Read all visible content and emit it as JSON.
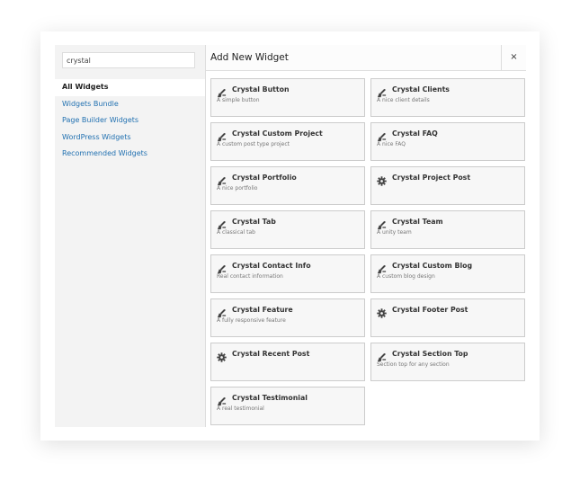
{
  "search": {
    "value": "crystal"
  },
  "sidebar": {
    "items": [
      {
        "label": "All Widgets",
        "active": true
      },
      {
        "label": "Widgets Bundle"
      },
      {
        "label": "Page Builder Widgets"
      },
      {
        "label": "WordPress Widgets"
      },
      {
        "label": "Recommended Widgets"
      }
    ]
  },
  "header": {
    "title": "Add New Widget",
    "close": "×"
  },
  "widgets": [
    {
      "name": "Crystal Button",
      "desc": "A simple button",
      "icon": "brush"
    },
    {
      "name": "Crystal Clients",
      "desc": "A nice client details",
      "icon": "brush"
    },
    {
      "name": "Crystal Custom Project",
      "desc": "A custom post type project",
      "icon": "brush"
    },
    {
      "name": "Crystal FAQ",
      "desc": "A nice FAQ",
      "icon": "brush"
    },
    {
      "name": "Crystal Portfolio",
      "desc": "A nice portfolio",
      "icon": "brush"
    },
    {
      "name": "Crystal Project Post",
      "desc": "",
      "icon": "gear"
    },
    {
      "name": "Crystal Tab",
      "desc": "A classical tab",
      "icon": "brush"
    },
    {
      "name": "Crystal Team",
      "desc": "A unity team",
      "icon": "brush"
    },
    {
      "name": "Crystal Contact Info",
      "desc": "Real contact information",
      "icon": "brush"
    },
    {
      "name": "Crystal Custom Blog",
      "desc": "A custom blog design",
      "icon": "brush"
    },
    {
      "name": "Crystal Feature",
      "desc": "A fully responsive feature",
      "icon": "brush"
    },
    {
      "name": "Crystal Footer Post",
      "desc": "",
      "icon": "gear"
    },
    {
      "name": "Crystal Recent Post",
      "desc": "",
      "icon": "gear"
    },
    {
      "name": "Crystal Section Top",
      "desc": "Section top for any section",
      "icon": "brush"
    },
    {
      "name": "Crystal Testimonial",
      "desc": "A real testimonial",
      "icon": "brush"
    }
  ]
}
